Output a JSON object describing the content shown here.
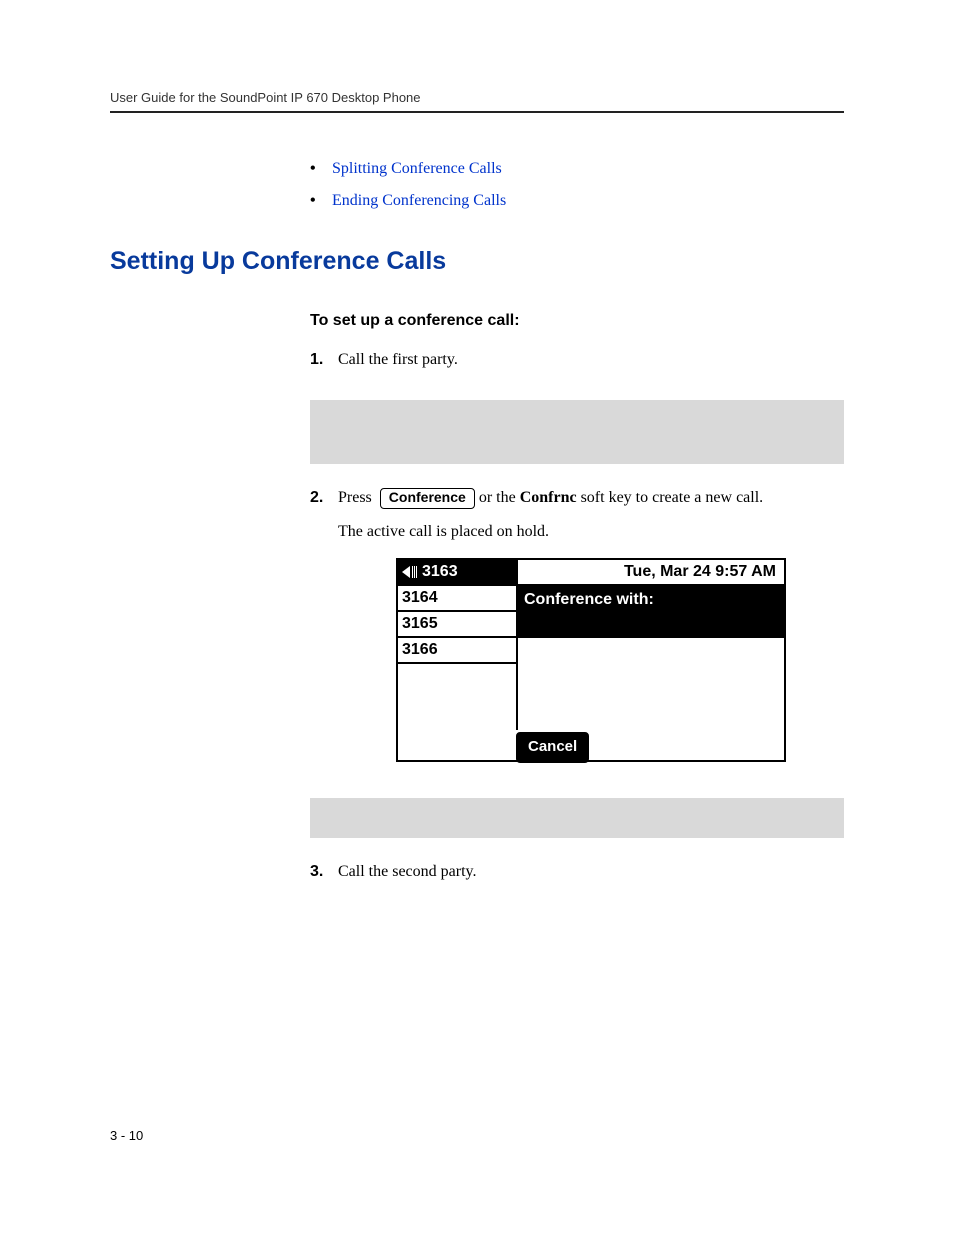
{
  "runningHead": "User Guide for the SoundPoint IP 670 Desktop Phone",
  "bullets": {
    "b1": "Splitting Conference Calls",
    "b2": "Ending Conferencing Calls"
  },
  "sectionTitle": "Setting Up Conference Calls",
  "procTitle": "To set up a conference call:",
  "steps": {
    "s1": {
      "num": "1.",
      "text": "Call the first party."
    },
    "s2": {
      "num": "2.",
      "pressWord": "Press",
      "keyLabel": "Conference",
      "middle": " or the ",
      "softkey": "Confrnc",
      "rest": " soft key to create a new call.",
      "hold": "The active call is placed on hold."
    },
    "s3": {
      "num": "3.",
      "text": "Call the second party."
    }
  },
  "phone": {
    "lines": {
      "l1": "3163",
      "l2": "3164",
      "l3": "3165",
      "l4": "3166"
    },
    "datetime": "Tue, Mar 24  9:57 AM",
    "confWith": "Conference with:",
    "cancel": "Cancel"
  },
  "pageNum": "3 - 10"
}
